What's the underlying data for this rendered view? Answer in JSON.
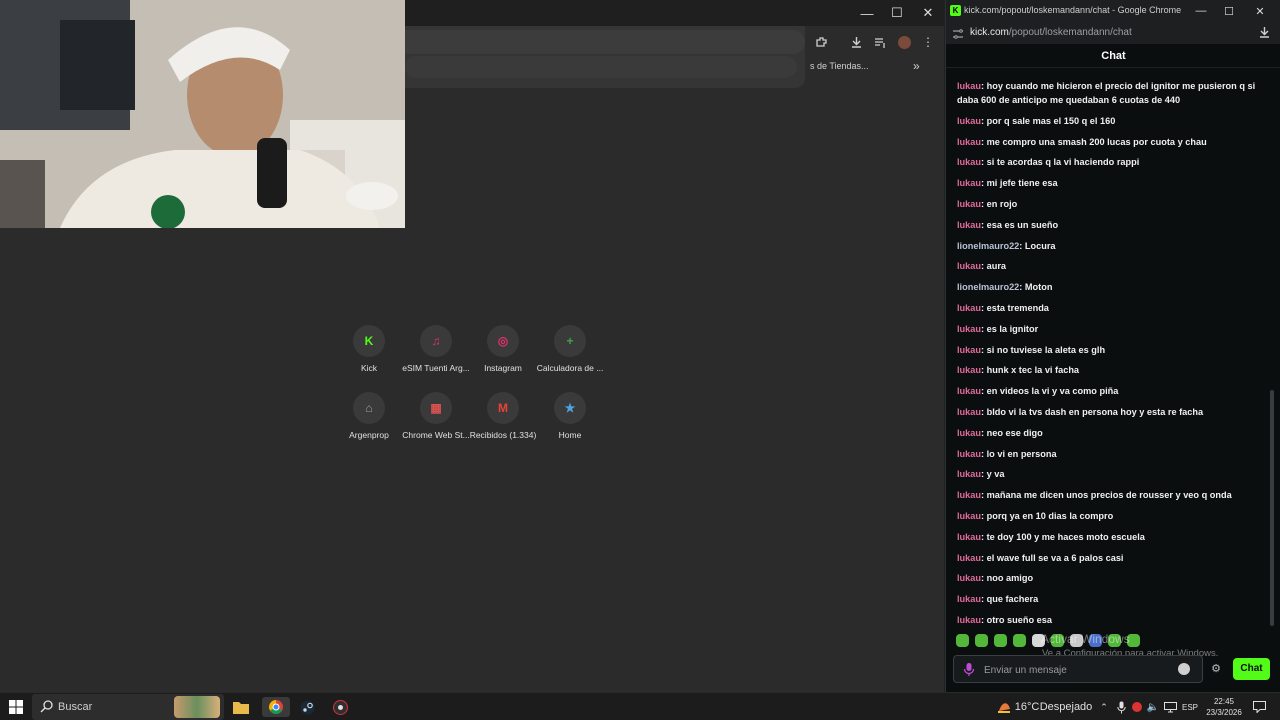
{
  "left_window": {
    "controls": {
      "minimize": "—",
      "maximize": "☐",
      "close": "✕"
    },
    "bookmark_text": "s de Tiendas...",
    "bookmark_more": "»",
    "shortcuts": [
      {
        "label": "Kick",
        "icon": "kick-icon",
        "glyph": "K",
        "color": "#53fc18"
      },
      {
        "label": "eSIM Tuenti Arg...",
        "icon": "esim-icon",
        "glyph": "♫",
        "color": "#e0306b"
      },
      {
        "label": "Instagram",
        "icon": "instagram-icon",
        "glyph": "◎",
        "color": "#e1306c"
      },
      {
        "label": "Calculadora de ...",
        "icon": "calculator-icon",
        "glyph": "+",
        "color": "#3fa34d"
      },
      {
        "label": "Argenprop",
        "icon": "argenprop-icon",
        "glyph": "⌂",
        "color": "#9aa0a6"
      },
      {
        "label": "Chrome Web St...",
        "icon": "webstore-icon",
        "glyph": "▦",
        "color": "#d9534f"
      },
      {
        "label": "Recibidos (1.334)",
        "icon": "gmail-icon",
        "glyph": "M",
        "color": "#ea4335"
      },
      {
        "label": "Home",
        "icon": "home-icon",
        "glyph": "★",
        "color": "#4fa3e0"
      }
    ]
  },
  "chat_window": {
    "title": "kick.com/popout/loskemandann/chat - Google Chrome",
    "url_domain": "kick.com",
    "url_path": "/popout/loskemandann/chat",
    "header": "Chat",
    "messages": [
      {
        "user": "lukau",
        "text": ": hoy cuando me hicieron el precio del ignitor me pusieron q si daba 600 de anticipo me quedaban 6 cuotas de 440"
      },
      {
        "user": "lukau",
        "text": ": por q sale mas el 150 q el 160"
      },
      {
        "user": "lukau",
        "text": ": me compro una smash 200 lucas por cuota y chau"
      },
      {
        "user": "lukau",
        "text": ": si te acordas q la vi haciendo rappi"
      },
      {
        "user": "lukau",
        "text": ": mi jefe tiene esa"
      },
      {
        "user": "lukau",
        "text": ": en rojo"
      },
      {
        "user": "lukau",
        "text": ": esa es un sueño"
      },
      {
        "user": "lionelmauro22",
        "text": ": Locura"
      },
      {
        "user": "lukau",
        "text": ": aura"
      },
      {
        "user": "lionelmauro22",
        "text": ": Moton"
      },
      {
        "user": "lukau",
        "text": ": esta tremenda"
      },
      {
        "user": "lukau",
        "text": ": es la ignitor"
      },
      {
        "user": "lukau",
        "text": ": si no tuviese la aleta es glh"
      },
      {
        "user": "lukau",
        "text": ": hunk x tec la vi facha"
      },
      {
        "user": "lukau",
        "text": ": en videos la vi y va como piña"
      },
      {
        "user": "lukau",
        "text": ": bldo vi la tvs dash en persona hoy y esta re facha"
      },
      {
        "user": "lukau",
        "text": ": neo ese digo"
      },
      {
        "user": "lukau",
        "text": ": lo vi en persona"
      },
      {
        "user": "lukau",
        "text": ": y va"
      },
      {
        "user": "lukau",
        "text": ": mañana me dicen unos precios de rousser y veo q onda"
      },
      {
        "user": "lukau",
        "text": ": porq ya en 10 dias la compro"
      },
      {
        "user": "lukau",
        "text": ": te doy 100 y me haces moto escuela"
      },
      {
        "user": "lukau",
        "text": ": el wave full se va a 6 palos casi"
      },
      {
        "user": "lukau",
        "text": ": noo amigo"
      },
      {
        "user": "lukau",
        "text": ": que fachera"
      },
      {
        "user": "lukau",
        "text": ": otro sueño esa"
      }
    ],
    "input_placeholder": "Enviar un mensaje",
    "send_label": "Chat",
    "activate_title": "Activar Windows",
    "activate_sub": "Ve a Configuración para activar Windows."
  },
  "taskbar": {
    "search_placeholder": "Buscar",
    "weather_temp": "16°C",
    "weather_text": "Despejado",
    "language": "ESP",
    "time": "22:45",
    "date": "23/3/2026"
  },
  "colors": {
    "kick_green": "#53fc18",
    "user_pink": "#e06b9c",
    "user_slate": "#b9c3d6"
  }
}
